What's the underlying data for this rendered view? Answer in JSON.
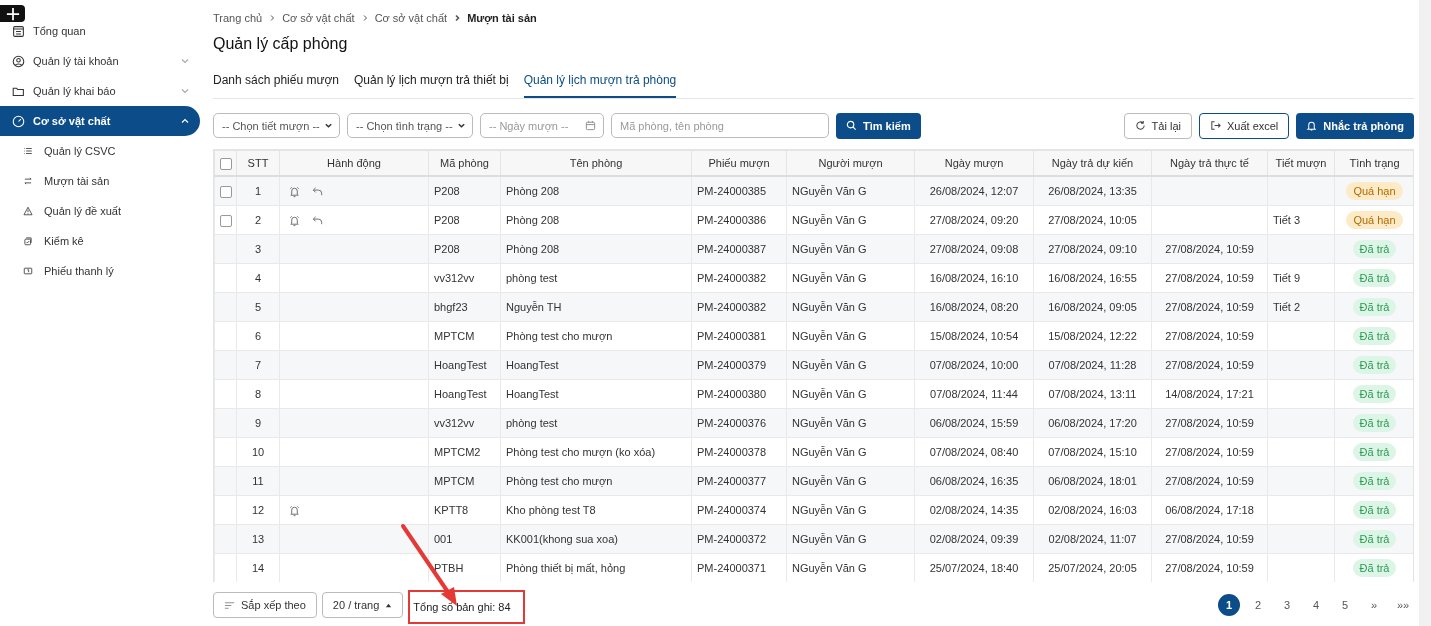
{
  "sidebar": {
    "items": [
      {
        "label": "Tổng quan",
        "selected": false
      },
      {
        "label": "Quản lý tài khoản",
        "selected": false,
        "expanded": false
      },
      {
        "label": "Quản lý khai báo",
        "selected": false,
        "expanded": false
      },
      {
        "label": "Cơ sở vật chất",
        "selected": true,
        "expanded": true,
        "children": [
          {
            "label": "Quản lý CSVC"
          },
          {
            "label": "Mượn tài sản"
          },
          {
            "label": "Quản lý đề xuất"
          },
          {
            "label": "Kiểm kê"
          },
          {
            "label": "Phiếu thanh lý"
          }
        ]
      }
    ]
  },
  "breadcrumb": [
    "Trang chủ",
    "Cơ sở vật chất",
    "Cơ sở vật chất",
    "Mượn tài sản"
  ],
  "title": "Quản lý cấp phòng",
  "tabs": [
    {
      "label": "Danh sách phiếu mượn",
      "selected": false
    },
    {
      "label": "Quản lý lịch mượn trả thiết bị",
      "selected": false
    },
    {
      "label": "Quản lý lịch mượn trả phòng",
      "selected": true
    }
  ],
  "filters": {
    "period": "-- Chọn tiết mượn --",
    "status": "-- Chọn tình trạng --",
    "date": {
      "placeholder": "-- Ngày mượn --"
    },
    "search": {
      "placeholder": "Mã phòng, tên phòng"
    },
    "search_button": "Tìm kiếm"
  },
  "actions": [
    {
      "label": "Tải lại",
      "kind": "reload"
    },
    {
      "label": "Xuất excel",
      "kind": "export"
    },
    {
      "label": "Nhắc trả phòng",
      "kind": "remind"
    }
  ],
  "table": {
    "columns": [
      "STT",
      "Hành động",
      "Mã phòng",
      "Tên phòng",
      "Phiếu mượn",
      "Người mượn",
      "Ngày mượn",
      "Ngày trả dự kiến",
      "Ngày trả thực tế",
      "Tiết mượn",
      "Tình trạng"
    ],
    "select_all_checked": false,
    "rows": [
      {
        "selectable": true,
        "checked": false,
        "stt": "1",
        "bell": true,
        "undo": true,
        "code": "P208",
        "name": "Phòng 208",
        "ticket": "PM-24000385",
        "borrower": "NGuyễn Văn G",
        "borrowed": "26/08/2024, 12:07",
        "due": "26/08/2024, 13:35",
        "returned": "",
        "period": "",
        "status": "Quá hạn",
        "kind": "overdue"
      },
      {
        "selectable": true,
        "checked": false,
        "stt": "2",
        "bell": true,
        "undo": true,
        "code": "P208",
        "name": "Phòng 208",
        "ticket": "PM-24000386",
        "borrower": "NGuyễn Văn G",
        "borrowed": "27/08/2024, 09:20",
        "due": "27/08/2024, 10:05",
        "returned": "",
        "period": "Tiết 3",
        "status": "Quá hạn",
        "kind": "overdue"
      },
      {
        "selectable": false,
        "stt": "3",
        "bell": false,
        "undo": false,
        "code": "P208",
        "name": "Phòng 208",
        "ticket": "PM-24000387",
        "borrower": "NGuyễn Văn G",
        "borrowed": "27/08/2024, 09:08",
        "due": "27/08/2024, 09:10",
        "returned": "27/08/2024, 10:59",
        "period": "",
        "status": "Đã trả",
        "kind": "returned"
      },
      {
        "selectable": false,
        "stt": "4",
        "bell": false,
        "undo": false,
        "code": "vv312vv",
        "name": "phòng test",
        "ticket": "PM-24000382",
        "borrower": "NGuyễn Văn G",
        "borrowed": "16/08/2024, 16:10",
        "due": "16/08/2024, 16:55",
        "returned": "27/08/2024, 10:59",
        "period": "Tiết 9",
        "status": "Đã trả",
        "kind": "returned"
      },
      {
        "selectable": false,
        "stt": "5",
        "bell": false,
        "undo": false,
        "code": "bhgf23",
        "name": "Nguyễn TH",
        "ticket": "PM-24000382",
        "borrower": "NGuyễn Văn G",
        "borrowed": "16/08/2024, 08:20",
        "due": "16/08/2024, 09:05",
        "returned": "27/08/2024, 10:59",
        "period": "Tiết 2",
        "status": "Đã trả",
        "kind": "returned"
      },
      {
        "selectable": false,
        "stt": "6",
        "bell": false,
        "undo": false,
        "code": "MPTCM",
        "name": "Phòng test cho mượn",
        "ticket": "PM-24000381",
        "borrower": "NGuyễn Văn G",
        "borrowed": "15/08/2024, 10:54",
        "due": "15/08/2024, 12:22",
        "returned": "27/08/2024, 10:59",
        "period": "",
        "status": "Đã trả",
        "kind": "returned"
      },
      {
        "selectable": false,
        "stt": "7",
        "bell": false,
        "undo": false,
        "code": "HoangTest",
        "name": "HoangTest",
        "ticket": "PM-24000379",
        "borrower": "NGuyễn Văn G",
        "borrowed": "07/08/2024, 10:00",
        "due": "07/08/2024, 11:28",
        "returned": "27/08/2024, 10:59",
        "period": "",
        "status": "Đã trả",
        "kind": "returned"
      },
      {
        "selectable": false,
        "stt": "8",
        "bell": false,
        "undo": false,
        "code": "HoangTest",
        "name": "HoangTest",
        "ticket": "PM-24000380",
        "borrower": "NGuyễn Văn G",
        "borrowed": "07/08/2024, 11:44",
        "due": "07/08/2024, 13:11",
        "returned": "14/08/2024, 17:21",
        "period": "",
        "status": "Đã trả",
        "kind": "returned"
      },
      {
        "selectable": false,
        "stt": "9",
        "bell": false,
        "undo": false,
        "code": "vv312vv",
        "name": "phòng test",
        "ticket": "PM-24000376",
        "borrower": "NGuyễn Văn G",
        "borrowed": "06/08/2024, 15:59",
        "due": "06/08/2024, 17:20",
        "returned": "27/08/2024, 10:59",
        "period": "",
        "status": "Đã trả",
        "kind": "returned"
      },
      {
        "selectable": false,
        "stt": "10",
        "bell": false,
        "undo": false,
        "code": "MPTCM2",
        "name": "Phòng test cho mượn (ko xóa)",
        "ticket": "PM-24000378",
        "borrower": "NGuyễn Văn G",
        "borrowed": "07/08/2024, 08:40",
        "due": "07/08/2024, 15:10",
        "returned": "27/08/2024, 10:59",
        "period": "",
        "status": "Đã trả",
        "kind": "returned"
      },
      {
        "selectable": false,
        "stt": "11",
        "bell": false,
        "undo": false,
        "code": "MPTCM",
        "name": "Phòng test cho mượn",
        "ticket": "PM-24000377",
        "borrower": "NGuyễn Văn G",
        "borrowed": "06/08/2024, 16:35",
        "due": "06/08/2024, 18:01",
        "returned": "27/08/2024, 10:59",
        "period": "",
        "status": "Đã trả",
        "kind": "returned"
      },
      {
        "selectable": false,
        "stt": "12",
        "bell": true,
        "undo": false,
        "code": "KPTT8",
        "name": "Kho phòng test T8",
        "ticket": "PM-24000374",
        "borrower": "NGuyễn Văn G",
        "borrowed": "02/08/2024, 14:35",
        "due": "02/08/2024, 16:03",
        "returned": "06/08/2024, 17:18",
        "period": "",
        "status": "Đã trả",
        "kind": "returned"
      },
      {
        "selectable": false,
        "stt": "13",
        "bell": false,
        "undo": false,
        "code": "001",
        "name": "KK001(khong sua xoa)",
        "ticket": "PM-24000372",
        "borrower": "NGuyễn Văn G",
        "borrowed": "02/08/2024, 09:39",
        "due": "02/08/2024, 11:07",
        "returned": "27/08/2024, 10:59",
        "period": "",
        "status": "Đã trả",
        "kind": "returned"
      },
      {
        "selectable": false,
        "stt": "14",
        "bell": false,
        "undo": false,
        "code": "PTBH",
        "name": "Phòng thiết bị mất, hỏng",
        "ticket": "PM-24000371",
        "borrower": "NGuyễn Văn G",
        "borrowed": "25/07/2024, 18:40",
        "due": "25/07/2024, 20:05",
        "returned": "27/08/2024, 10:59",
        "period": "",
        "status": "Đã trả",
        "kind": "returned"
      }
    ]
  },
  "footer": {
    "sort": "Sắp xếp theo",
    "page_size": "20 / trang",
    "total": "Tổng số bản ghi: 84",
    "pages": [
      {
        "label": "1",
        "selected": true
      },
      {
        "label": "2",
        "selected": false
      },
      {
        "label": "3",
        "selected": false
      },
      {
        "label": "4",
        "selected": false
      },
      {
        "label": "5",
        "selected": false
      },
      {
        "label": "»",
        "selected": false
      },
      {
        "label": "»»",
        "selected": false
      }
    ]
  }
}
